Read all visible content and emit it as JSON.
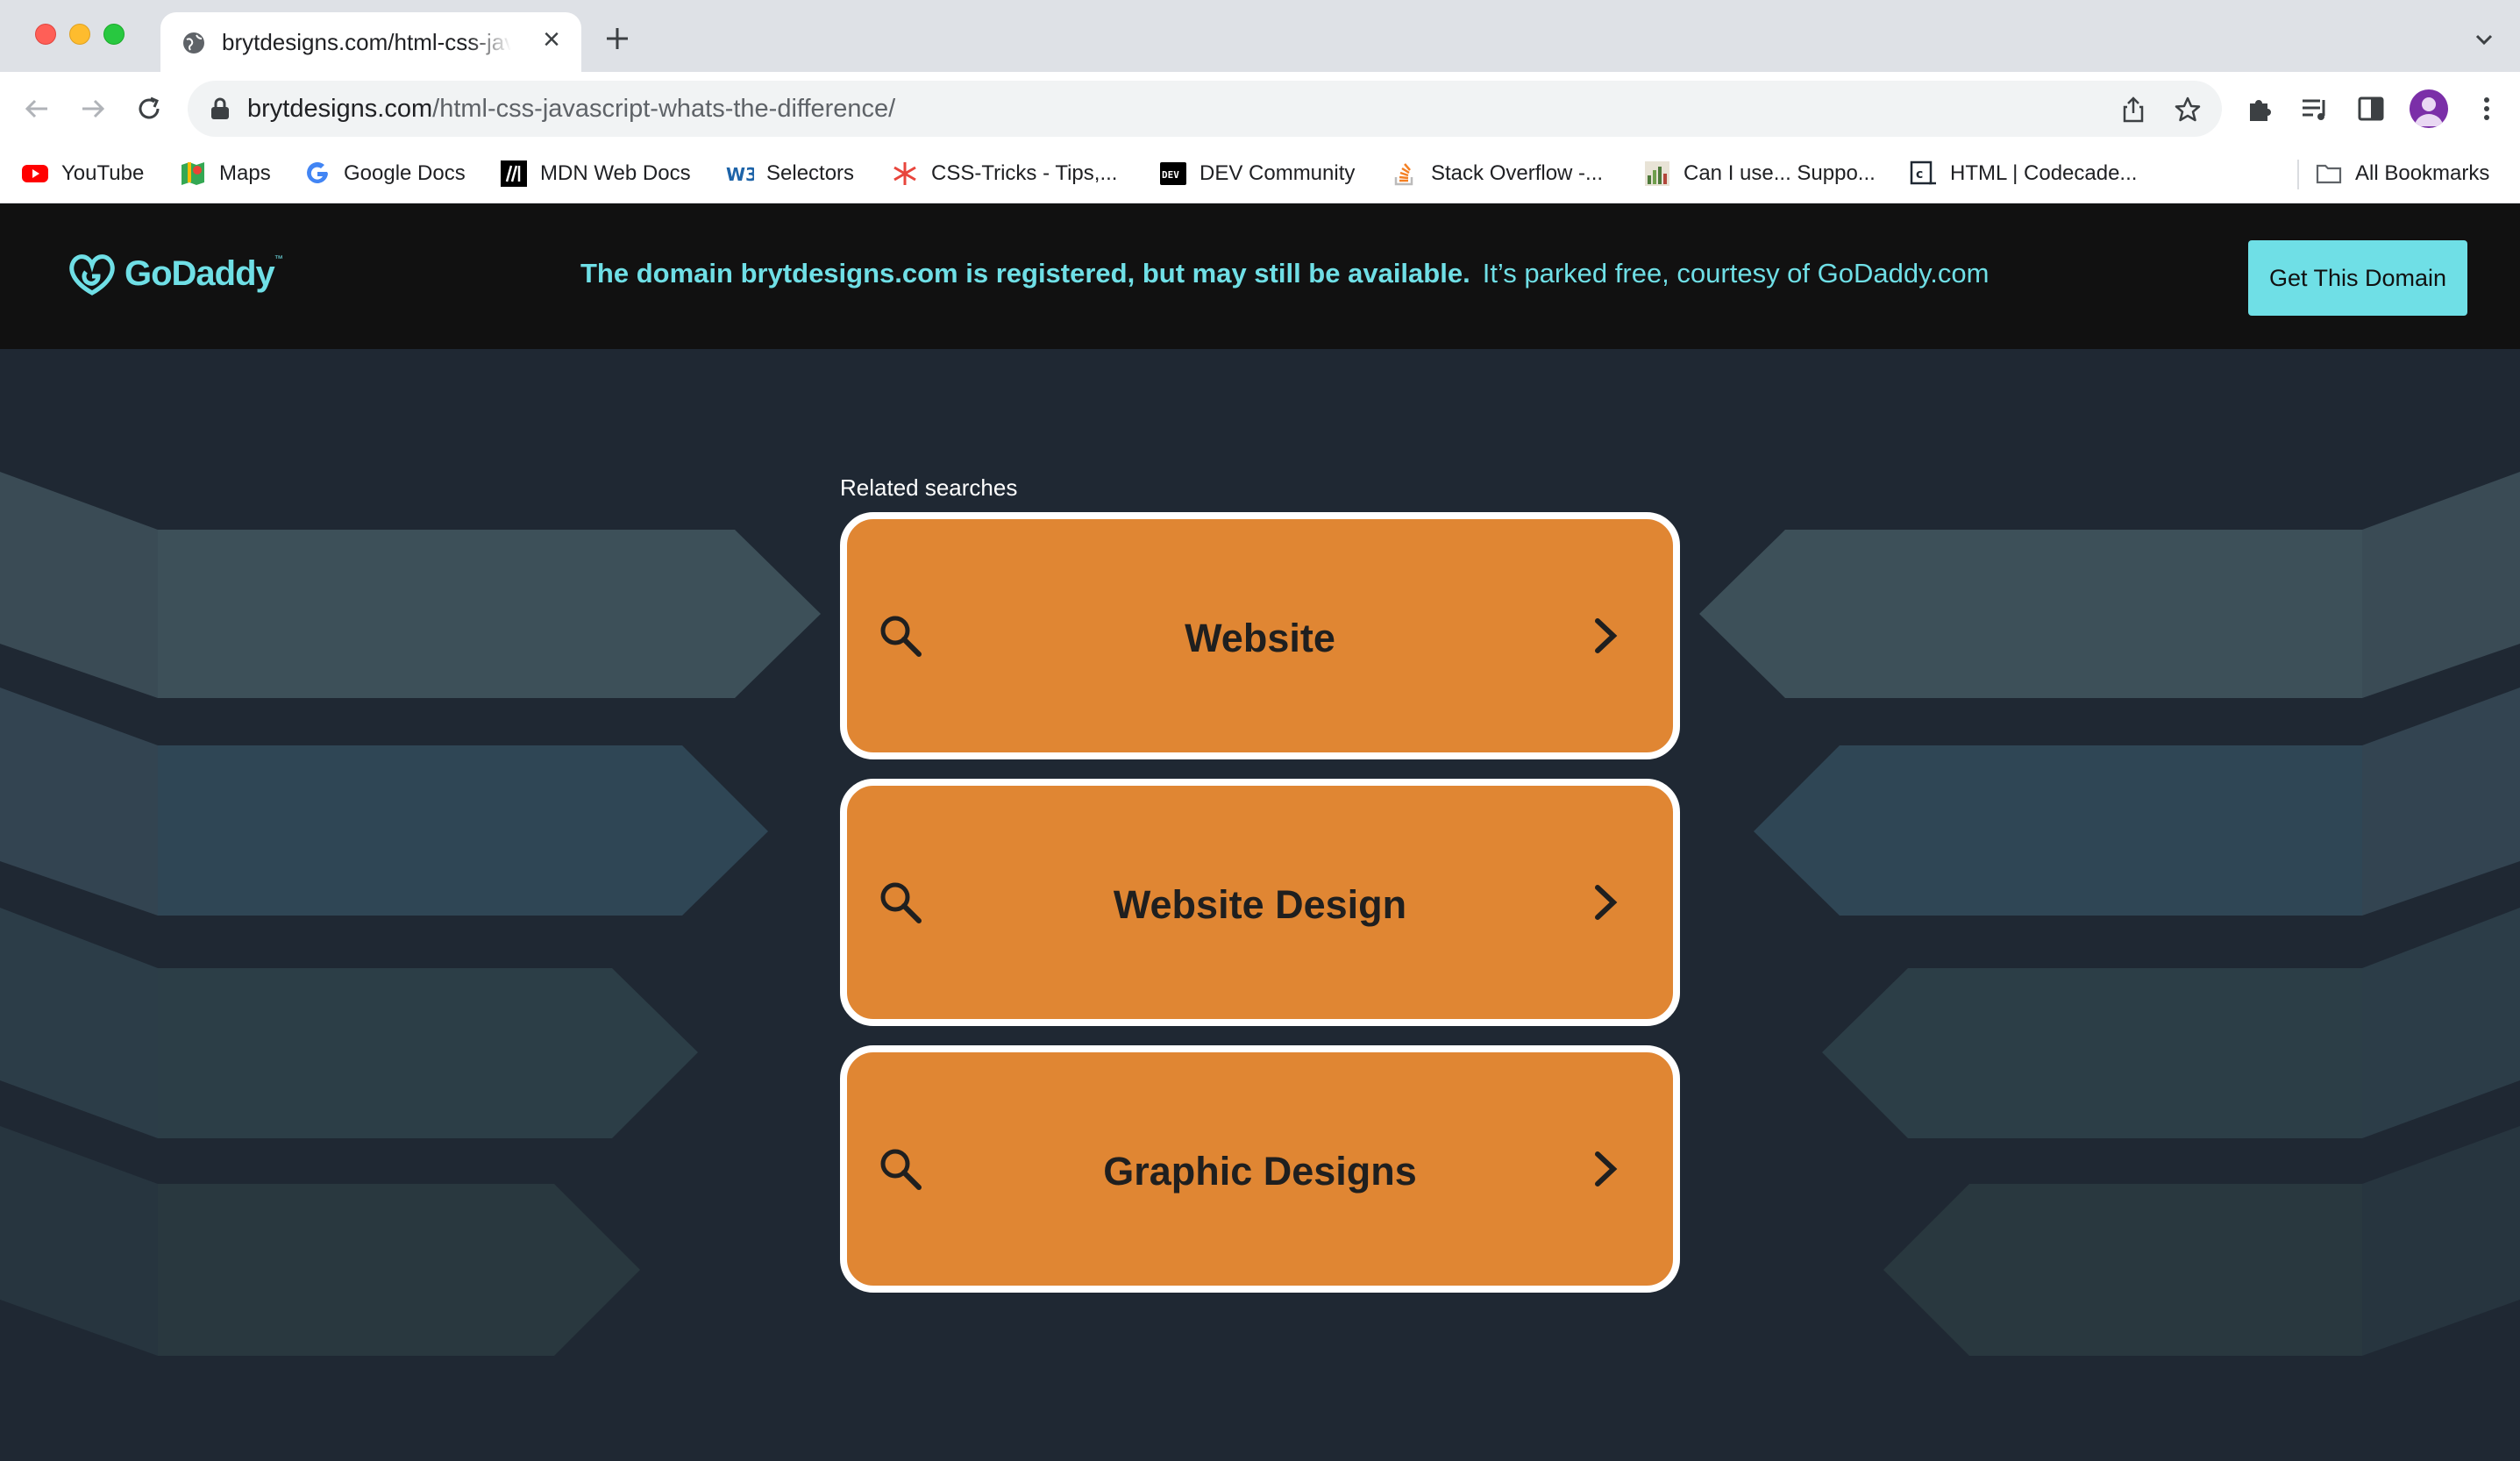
{
  "browser": {
    "tab": {
      "title": "brytdesigns.com/html-css-javascript-whats-the-difference/"
    },
    "address": {
      "domain": "brytdesigns.com",
      "path": "/html-css-javascript-whats-the-difference/"
    },
    "bookmarks": [
      {
        "label": "YouTube",
        "icon": "youtube-icon"
      },
      {
        "label": "Maps",
        "icon": "maps-icon"
      },
      {
        "label": "Google Docs",
        "icon": "google-icon"
      },
      {
        "label": "MDN Web Docs",
        "icon": "mdn-icon"
      },
      {
        "label": "Selectors",
        "icon": "w3-icon"
      },
      {
        "label": "CSS-Tricks - Tips,...",
        "icon": "css-tricks-icon"
      },
      {
        "label": "DEV Community",
        "icon": "dev-icon"
      },
      {
        "label": "Stack Overflow -...",
        "icon": "stackoverflow-icon"
      },
      {
        "label": "Can I use... Suppo...",
        "icon": "caniuse-icon"
      },
      {
        "label": "HTML | Codecade...",
        "icon": "codecademy-icon"
      }
    ],
    "all_bookmarks_label": "All Bookmarks"
  },
  "page": {
    "logo_text": "GoDaddy",
    "logo_tm": "™",
    "notice_bold": "The domain brytdesigns.com is registered, but may still be available.",
    "notice_light": "It’s parked free, courtesy of GoDaddy.com",
    "cta_label": "Get This Domain",
    "related_label": "Related searches",
    "searches": [
      "Website",
      "Website Design",
      "Graphic Designs"
    ]
  },
  "colors": {
    "accent": "#6fdfe6",
    "card": "#e08633",
    "page_bg": "#1f2833",
    "header_bg": "#111111"
  }
}
